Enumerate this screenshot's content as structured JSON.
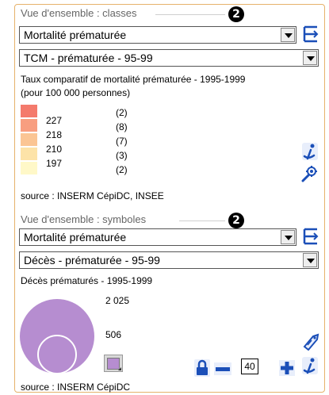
{
  "classes": {
    "section_title": "Vue d'ensemble : classes",
    "step_badge": "2",
    "indicator_select": "Mortalité prématurée",
    "variable_select": "TCM - prématurée - 95-99",
    "legend_title_line1": "Taux comparatif de mortalité prématurée - 1995-1999",
    "legend_title_line2": "(pour 100 000 personnes)",
    "legend": [
      {
        "color": "#f47a6c",
        "label": "227",
        "count": "(2)"
      },
      {
        "color": "#f89e80",
        "label": "218",
        "count": "(8)"
      },
      {
        "color": "#fbc594",
        "label": "210",
        "count": "(7)"
      },
      {
        "color": "#fde3a8",
        "label": "197",
        "count": "(3)"
      },
      {
        "color": "#fff8c8",
        "label": "",
        "count": "(2)"
      }
    ],
    "source": "source : INSERM CépiDC, INSEE"
  },
  "symbols": {
    "section_title": "Vue d'ensemble : symboles",
    "step_badge": "2",
    "indicator_select": "Mortalité prématurée",
    "variable_select": "Décès - prématurée - 95-99",
    "legend_title": "Décès prématurés - 1995-1999",
    "circle_large_value": "2 025",
    "circle_small_value": "506",
    "symbol_color": "#b68dd0",
    "size_value": "40",
    "source": "source : INSERM CépiDC"
  },
  "colors": {
    "border": "#e6b26b",
    "icon_blue": "#1b4fb8"
  }
}
